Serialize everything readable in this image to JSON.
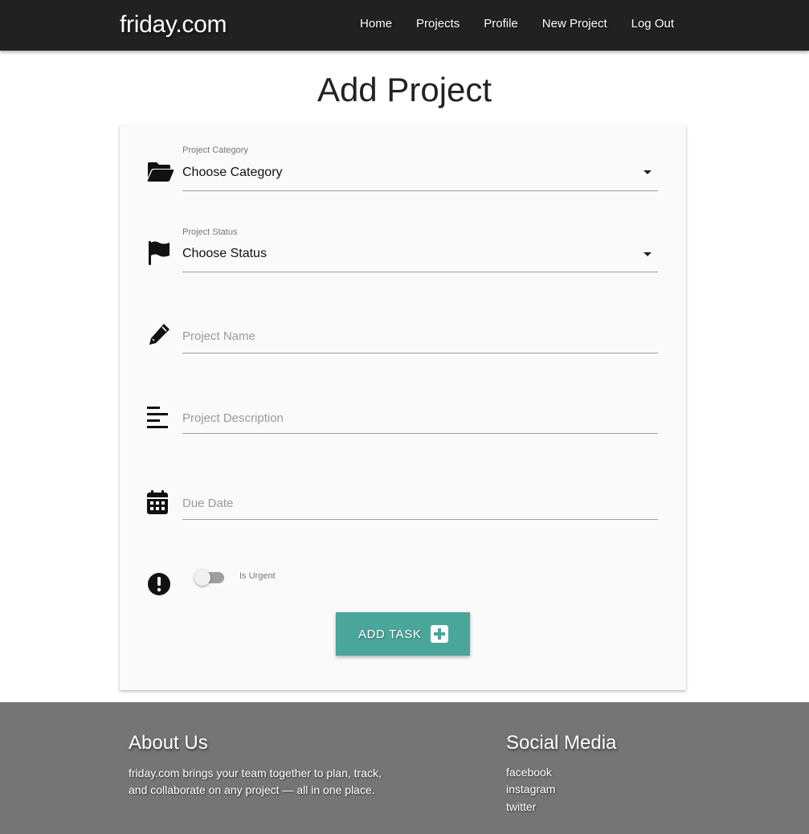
{
  "navbar": {
    "brand": "friday.com",
    "links": [
      {
        "label": "Home"
      },
      {
        "label": "Projects"
      },
      {
        "label": "Profile"
      },
      {
        "label": "New Project"
      },
      {
        "label": "Log Out"
      }
    ]
  },
  "page": {
    "title": "Add Project"
  },
  "form": {
    "category": {
      "label": "Project Category",
      "value": "Choose Category",
      "icon": "folder-open-icon"
    },
    "status": {
      "label": "Project Status",
      "value": "Choose Status",
      "icon": "flag-icon"
    },
    "name": {
      "placeholder": "Project Name",
      "icon": "pencil-icon"
    },
    "description": {
      "placeholder": "Project Description",
      "icon": "align-left-icon"
    },
    "due_date": {
      "placeholder": "Due Date",
      "icon": "calendar-icon"
    },
    "urgent": {
      "label": "Is Urgent",
      "checked": false,
      "icon": "exclamation-circle-icon"
    },
    "submit": {
      "label": "ADD TASK",
      "icon": "plus-square-icon"
    }
  },
  "footer": {
    "about": {
      "heading": "About Us",
      "line1": "friday.com brings your team together to plan, track,",
      "line2": "and collaborate on any project — all in one place."
    },
    "social": {
      "heading": "Social Media",
      "links": [
        {
          "label": "facebook"
        },
        {
          "label": "instagram"
        },
        {
          "label": "twitter"
        }
      ]
    }
  },
  "colors": {
    "navbar_bg": "#212121",
    "card_bg": "#fafafa",
    "button_bg": "#4aa59a",
    "footer_bg": "#757575"
  }
}
